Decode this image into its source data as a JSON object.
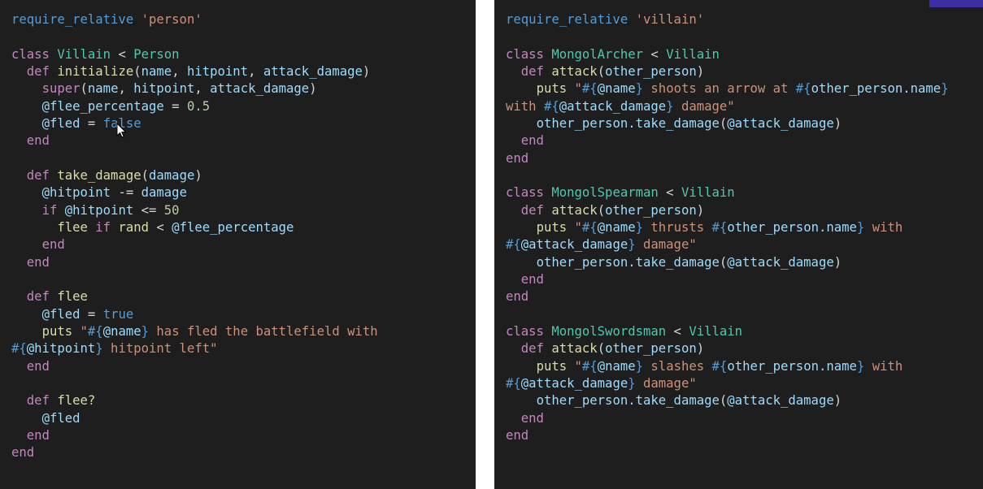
{
  "left_panel": {
    "lines": [
      [
        {
          "t": "require_relative",
          "c": "req"
        },
        {
          "t": " "
        },
        {
          "t": "'person'",
          "c": "str"
        }
      ],
      [],
      [
        {
          "t": "class",
          "c": "kw"
        },
        {
          "t": " "
        },
        {
          "t": "Villain",
          "c": "cls"
        },
        {
          "t": " < "
        },
        {
          "t": "Person",
          "c": "cls"
        }
      ],
      [
        {
          "t": "  "
        },
        {
          "t": "def",
          "c": "kw"
        },
        {
          "t": " "
        },
        {
          "t": "initialize",
          "c": "fn"
        },
        {
          "t": "("
        },
        {
          "t": "name",
          "c": "var"
        },
        {
          "t": ", "
        },
        {
          "t": "hitpoint",
          "c": "var"
        },
        {
          "t": ", "
        },
        {
          "t": "attack_damage",
          "c": "var"
        },
        {
          "t": ")"
        }
      ],
      [
        {
          "t": "    "
        },
        {
          "t": "super",
          "c": "kw"
        },
        {
          "t": "("
        },
        {
          "t": "name",
          "c": "var"
        },
        {
          "t": ", "
        },
        {
          "t": "hitpoint",
          "c": "var"
        },
        {
          "t": ", "
        },
        {
          "t": "attack_damage",
          "c": "var"
        },
        {
          "t": ")"
        }
      ],
      [
        {
          "t": "    "
        },
        {
          "t": "@flee_percentage",
          "c": "iv"
        },
        {
          "t": " = "
        },
        {
          "t": "0.5",
          "c": "num"
        }
      ],
      [
        {
          "t": "    "
        },
        {
          "t": "@fled",
          "c": "iv"
        },
        {
          "t": " = "
        },
        {
          "t": "false",
          "c": "con"
        }
      ],
      [
        {
          "t": "  "
        },
        {
          "t": "end",
          "c": "kw"
        }
      ],
      [],
      [
        {
          "t": "  "
        },
        {
          "t": "def",
          "c": "kw"
        },
        {
          "t": " "
        },
        {
          "t": "take_damage",
          "c": "fn"
        },
        {
          "t": "("
        },
        {
          "t": "damage",
          "c": "var"
        },
        {
          "t": ")"
        }
      ],
      [
        {
          "t": "    "
        },
        {
          "t": "@hitpoint",
          "c": "iv"
        },
        {
          "t": " -= "
        },
        {
          "t": "damage",
          "c": "var"
        }
      ],
      [
        {
          "t": "    "
        },
        {
          "t": "if",
          "c": "kw"
        },
        {
          "t": " "
        },
        {
          "t": "@hitpoint",
          "c": "iv"
        },
        {
          "t": " <= "
        },
        {
          "t": "50",
          "c": "num"
        }
      ],
      [
        {
          "t": "      "
        },
        {
          "t": "flee",
          "c": "fn"
        },
        {
          "t": " "
        },
        {
          "t": "if",
          "c": "kw"
        },
        {
          "t": " "
        },
        {
          "t": "rand",
          "c": "fn"
        },
        {
          "t": " < "
        },
        {
          "t": "@flee_percentage",
          "c": "iv"
        }
      ],
      [
        {
          "t": "    "
        },
        {
          "t": "end",
          "c": "kw"
        }
      ],
      [
        {
          "t": "  "
        },
        {
          "t": "end",
          "c": "kw"
        }
      ],
      [],
      [
        {
          "t": "  "
        },
        {
          "t": "def",
          "c": "kw"
        },
        {
          "t": " "
        },
        {
          "t": "flee",
          "c": "fn"
        }
      ],
      [
        {
          "t": "    "
        },
        {
          "t": "@fled",
          "c": "iv"
        },
        {
          "t": " = "
        },
        {
          "t": "true",
          "c": "con"
        }
      ],
      [
        {
          "t": "    "
        },
        {
          "t": "puts",
          "c": "fn"
        },
        {
          "t": " "
        },
        {
          "t": "\"",
          "c": "str"
        },
        {
          "t": "#{",
          "c": "interp"
        },
        {
          "t": "@name",
          "c": "iv"
        },
        {
          "t": "}",
          "c": "interp"
        },
        {
          "t": " has fled the battlefield with",
          "c": "str"
        }
      ],
      [
        {
          "t": "#{",
          "c": "interp"
        },
        {
          "t": "@hitpoint",
          "c": "iv"
        },
        {
          "t": "}",
          "c": "interp"
        },
        {
          "t": " hitpoint left\"",
          "c": "str"
        }
      ],
      [
        {
          "t": "  "
        },
        {
          "t": "end",
          "c": "kw"
        }
      ],
      [],
      [
        {
          "t": "  "
        },
        {
          "t": "def",
          "c": "kw"
        },
        {
          "t": " "
        },
        {
          "t": "flee?",
          "c": "fn"
        }
      ],
      [
        {
          "t": "    "
        },
        {
          "t": "@fled",
          "c": "iv"
        }
      ],
      [
        {
          "t": "  "
        },
        {
          "t": "end",
          "c": "kw"
        }
      ],
      [
        {
          "t": "end",
          "c": "kw"
        }
      ]
    ]
  },
  "right_panel": {
    "lines": [
      [
        {
          "t": "require_relative",
          "c": "req"
        },
        {
          "t": " "
        },
        {
          "t": "'villain'",
          "c": "str"
        }
      ],
      [],
      [
        {
          "t": "class",
          "c": "kw"
        },
        {
          "t": " "
        },
        {
          "t": "MongolArcher",
          "c": "cls"
        },
        {
          "t": " < "
        },
        {
          "t": "Villain",
          "c": "cls"
        }
      ],
      [
        {
          "t": "  "
        },
        {
          "t": "def",
          "c": "kw"
        },
        {
          "t": " "
        },
        {
          "t": "attack",
          "c": "fn"
        },
        {
          "t": "("
        },
        {
          "t": "other_person",
          "c": "var"
        },
        {
          "t": ")"
        }
      ],
      [
        {
          "t": "    "
        },
        {
          "t": "puts",
          "c": "fn"
        },
        {
          "t": " "
        },
        {
          "t": "\"",
          "c": "str"
        },
        {
          "t": "#{",
          "c": "interp"
        },
        {
          "t": "@name",
          "c": "iv"
        },
        {
          "t": "}",
          "c": "interp"
        },
        {
          "t": " shoots an arrow at ",
          "c": "str"
        },
        {
          "t": "#{",
          "c": "interp"
        },
        {
          "t": "other_person.name",
          "c": "var"
        },
        {
          "t": "}",
          "c": "interp"
        }
      ],
      [
        {
          "t": "with ",
          "c": "str"
        },
        {
          "t": "#{",
          "c": "interp"
        },
        {
          "t": "@attack_damage",
          "c": "iv"
        },
        {
          "t": "}",
          "c": "interp"
        },
        {
          "t": " damage\"",
          "c": "str"
        }
      ],
      [
        {
          "t": "    "
        },
        {
          "t": "other_person.take_damage",
          "c": "var"
        },
        {
          "t": "("
        },
        {
          "t": "@attack_damage",
          "c": "iv"
        },
        {
          "t": ")"
        }
      ],
      [
        {
          "t": "  "
        },
        {
          "t": "end",
          "c": "kw"
        }
      ],
      [
        {
          "t": "end",
          "c": "kw"
        }
      ],
      [],
      [
        {
          "t": "class",
          "c": "kw"
        },
        {
          "t": " "
        },
        {
          "t": "MongolSpearman",
          "c": "cls"
        },
        {
          "t": " < "
        },
        {
          "t": "Villain",
          "c": "cls"
        }
      ],
      [
        {
          "t": "  "
        },
        {
          "t": "def",
          "c": "kw"
        },
        {
          "t": " "
        },
        {
          "t": "attack",
          "c": "fn"
        },
        {
          "t": "("
        },
        {
          "t": "other_person",
          "c": "var"
        },
        {
          "t": ")"
        }
      ],
      [
        {
          "t": "    "
        },
        {
          "t": "puts",
          "c": "fn"
        },
        {
          "t": " "
        },
        {
          "t": "\"",
          "c": "str"
        },
        {
          "t": "#{",
          "c": "interp"
        },
        {
          "t": "@name",
          "c": "iv"
        },
        {
          "t": "}",
          "c": "interp"
        },
        {
          "t": " thrusts ",
          "c": "str"
        },
        {
          "t": "#{",
          "c": "interp"
        },
        {
          "t": "other_person.name",
          "c": "var"
        },
        {
          "t": "}",
          "c": "interp"
        },
        {
          "t": " with",
          "c": "str"
        }
      ],
      [
        {
          "t": "#{",
          "c": "interp"
        },
        {
          "t": "@attack_damage",
          "c": "iv"
        },
        {
          "t": "}",
          "c": "interp"
        },
        {
          "t": " damage\"",
          "c": "str"
        }
      ],
      [
        {
          "t": "    "
        },
        {
          "t": "other_person.take_damage",
          "c": "var"
        },
        {
          "t": "("
        },
        {
          "t": "@attack_damage",
          "c": "iv"
        },
        {
          "t": ")"
        }
      ],
      [
        {
          "t": "  "
        },
        {
          "t": "end",
          "c": "kw"
        }
      ],
      [
        {
          "t": "end",
          "c": "kw"
        }
      ],
      [],
      [
        {
          "t": "class",
          "c": "kw"
        },
        {
          "t": " "
        },
        {
          "t": "MongolSwordsman",
          "c": "cls"
        },
        {
          "t": " < "
        },
        {
          "t": "Villain",
          "c": "cls"
        }
      ],
      [
        {
          "t": "  "
        },
        {
          "t": "def",
          "c": "kw"
        },
        {
          "t": " "
        },
        {
          "t": "attack",
          "c": "fn"
        },
        {
          "t": "("
        },
        {
          "t": "other_person",
          "c": "var"
        },
        {
          "t": ")"
        }
      ],
      [
        {
          "t": "    "
        },
        {
          "t": "puts",
          "c": "fn"
        },
        {
          "t": " "
        },
        {
          "t": "\"",
          "c": "str"
        },
        {
          "t": "#{",
          "c": "interp"
        },
        {
          "t": "@name",
          "c": "iv"
        },
        {
          "t": "}",
          "c": "interp"
        },
        {
          "t": " slashes ",
          "c": "str"
        },
        {
          "t": "#{",
          "c": "interp"
        },
        {
          "t": "other_person.name",
          "c": "var"
        },
        {
          "t": "}",
          "c": "interp"
        },
        {
          "t": " with",
          "c": "str"
        }
      ],
      [
        {
          "t": "#{",
          "c": "interp"
        },
        {
          "t": "@attack_damage",
          "c": "iv"
        },
        {
          "t": "}",
          "c": "interp"
        },
        {
          "t": " damage\"",
          "c": "str"
        }
      ],
      [
        {
          "t": "    "
        },
        {
          "t": "other_person.take_damage",
          "c": "var"
        },
        {
          "t": "("
        },
        {
          "t": "@attack_damage",
          "c": "iv"
        },
        {
          "t": ")"
        }
      ],
      [
        {
          "t": "  "
        },
        {
          "t": "end",
          "c": "kw"
        }
      ],
      [
        {
          "t": "end",
          "c": "kw"
        }
      ]
    ]
  },
  "icons": {
    "cursor": "mouse-pointer-icon"
  }
}
